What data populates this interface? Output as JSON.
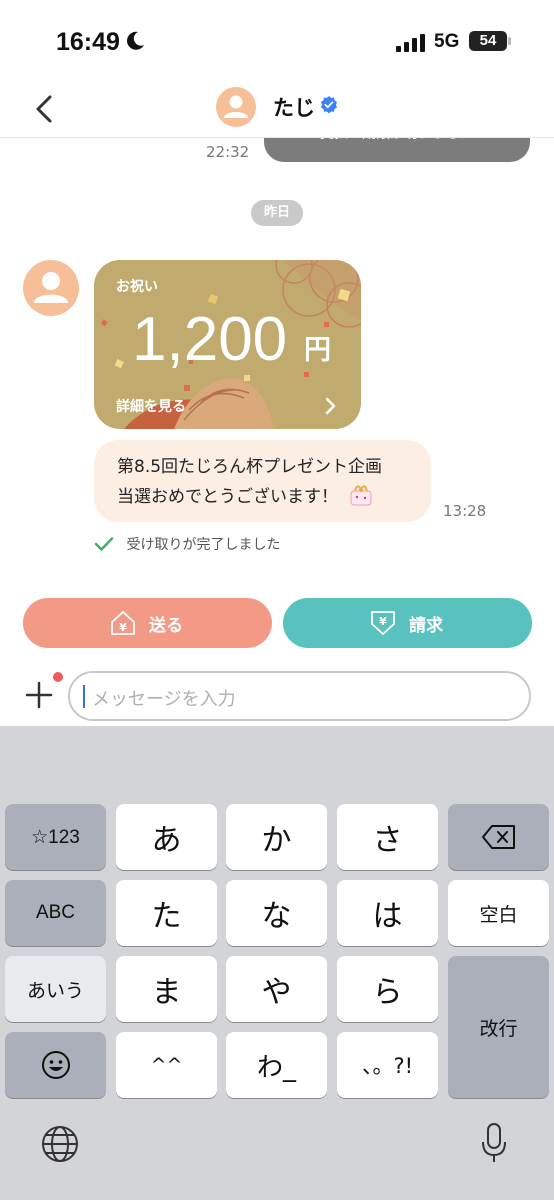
{
  "status_bar": {
    "time": "16:49",
    "network": "5G",
    "battery": "54"
  },
  "header": {
    "contact_name": "たじ"
  },
  "chat": {
    "previous_message_text": "支払い期限が切れました",
    "previous_message_time": "22:32",
    "date_separator": "昨日",
    "gift_card": {
      "label": "お祝い",
      "amount": "1,200",
      "currency": "円",
      "detail_link": "詳細を見る"
    },
    "message_line1": "第8.5回たじろん杯プレゼント企画",
    "message_line2": "当選おめでとうございます！",
    "message_time": "13:28",
    "received_status": "受け取りが完了しました"
  },
  "actions": {
    "send_label": "送る",
    "request_label": "請求"
  },
  "composer": {
    "placeholder": "メッセージを入力"
  },
  "keyboard": {
    "row1": [
      "☆123",
      "あ",
      "か",
      "さ"
    ],
    "row2": [
      "ABC",
      "た",
      "な",
      "は",
      "空白"
    ],
    "row3": [
      "あいう",
      "ま",
      "や",
      "ら",
      "改行"
    ],
    "row4": [
      "^^",
      "わ_",
      "、。?!"
    ]
  },
  "colors": {
    "send_button": "#f29a86",
    "request_button": "#59c1be",
    "gift_card": "#c0aa6d",
    "message_bubble": "#fdeee4",
    "avatar": "#f6bf98",
    "verified_badge": "#3b82f6",
    "received_check": "#3fae6a"
  }
}
